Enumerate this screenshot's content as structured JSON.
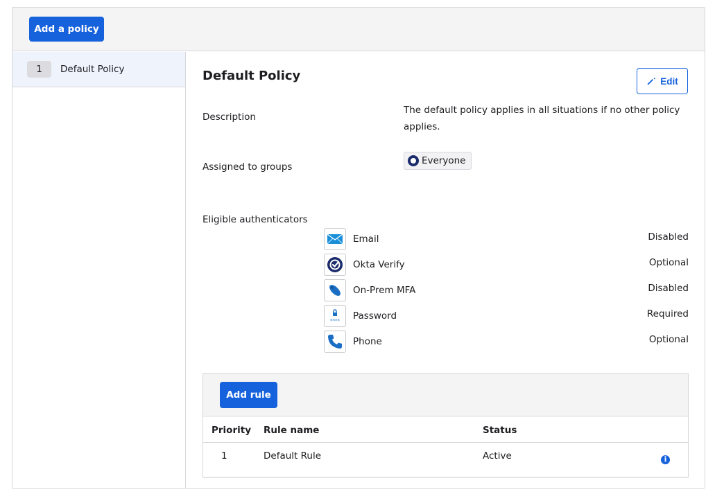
{
  "toolbar": {
    "add_policy_label": "Add a policy"
  },
  "sidebar": {
    "policies": [
      {
        "priority": "1",
        "name": "Default Policy"
      }
    ]
  },
  "policy": {
    "title": "Default Policy",
    "edit_label": "Edit",
    "description_label": "Description",
    "description_value": "The default policy applies in all situations if no other policy applies.",
    "groups_label": "Assigned to groups",
    "groups": [
      "Everyone"
    ],
    "authenticators_label": "Eligible authenticators",
    "authenticators": [
      {
        "name": "Email",
        "status": "Disabled",
        "icon": "email-icon"
      },
      {
        "name": "Okta Verify",
        "status": "Optional",
        "icon": "okta-verify-icon"
      },
      {
        "name": "On-Prem MFA",
        "status": "Disabled",
        "icon": "on-prem-mfa-icon"
      },
      {
        "name": "Password",
        "status": "Required",
        "icon": "password-icon"
      },
      {
        "name": "Phone",
        "status": "Optional",
        "icon": "phone-icon"
      }
    ]
  },
  "rules": {
    "add_rule_label": "Add rule",
    "columns": [
      "Priority",
      "Rule name",
      "Status"
    ],
    "rows": [
      {
        "priority": "1",
        "name": "Default Rule",
        "status": "Active"
      }
    ]
  },
  "colors": {
    "primary": "#1662dd",
    "selected_bg": "#eff3fc",
    "header_bg": "#f4f4f4",
    "okta_navy": "#1a2b6b"
  }
}
